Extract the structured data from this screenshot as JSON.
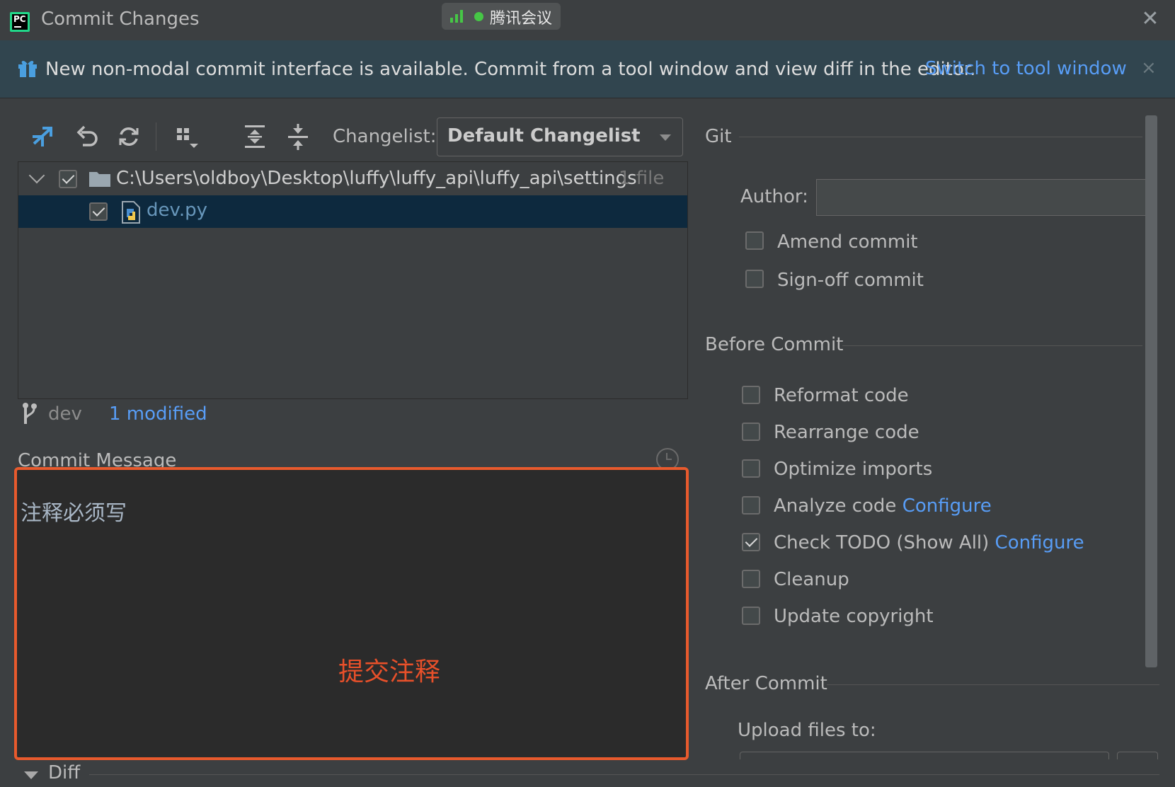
{
  "window": {
    "title": "Commit Changes",
    "close_icon": "close-icon"
  },
  "meeting": {
    "label": "腾讯会议",
    "status_color": "#46c646"
  },
  "banner": {
    "text": "New non-modal commit interface is available. Commit from a tool window and view diff in the editor.",
    "link": "Switch to tool window",
    "close": "×"
  },
  "toolbar": {
    "icons": [
      "compare-icon",
      "rollback-icon",
      "refresh-icon",
      "group-by-icon",
      "expand-all-icon",
      "collapse-all-icon"
    ],
    "changelist_label": "Changelist:",
    "changelist_value": "Default Changelist"
  },
  "tree": {
    "folder": {
      "path": "C:\\Users\\oldboy\\Desktop\\luffy\\luffy_api\\luffy_api\\settings",
      "count": "1 file",
      "checked": true
    },
    "file": {
      "name": "dev.py",
      "checked": true
    }
  },
  "status": {
    "branch": "dev",
    "modified": "1 modified"
  },
  "commit": {
    "label": "Commit Message",
    "text": "注释必须写",
    "annotation": "提交注释",
    "highlight_color": "#e85a2d"
  },
  "diff": {
    "label": "Diff"
  },
  "git": {
    "title": "Git",
    "author_label": "Author:",
    "author_value": "",
    "options": [
      {
        "label": "Amend commit",
        "checked": false
      },
      {
        "label": "Sign-off commit",
        "checked": false
      }
    ]
  },
  "before_commit": {
    "title": "Before Commit",
    "options": [
      {
        "label": "Reformat code",
        "checked": false,
        "link": ""
      },
      {
        "label": "Rearrange code",
        "checked": false,
        "link": ""
      },
      {
        "label": "Optimize imports",
        "checked": false,
        "link": ""
      },
      {
        "label": "Analyze code",
        "checked": false,
        "link": "Configure"
      },
      {
        "label": "Check TODO (Show All)",
        "checked": true,
        "link": "Configure"
      },
      {
        "label": "Cleanup",
        "checked": false,
        "link": ""
      },
      {
        "label": "Update copyright",
        "checked": false,
        "link": ""
      }
    ]
  },
  "after_commit": {
    "title": "After Commit",
    "upload_label": "Upload files to:"
  },
  "colors": {
    "background": "#3c3f41",
    "link": "#589df6",
    "selection": "#0d293e"
  }
}
